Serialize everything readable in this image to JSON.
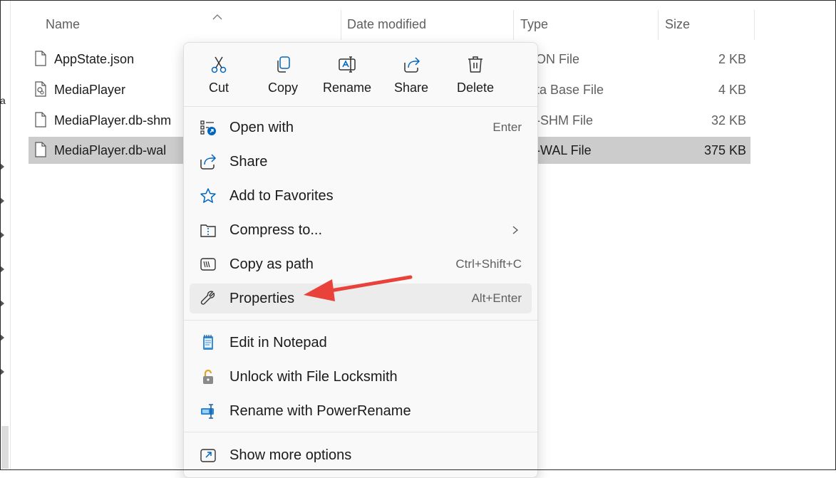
{
  "header": {
    "name": "Name",
    "date_modified": "Date modified",
    "type": "Type",
    "size": "Size"
  },
  "sidebar_stub": "a",
  "files": [
    {
      "name": "AppState.json",
      "type": "ON File",
      "size": "2 KB",
      "icon": "document-icon",
      "selected": false
    },
    {
      "name": "MediaPlayer",
      "type": "ta Base File",
      "size": "4 KB",
      "icon": "database-file-icon",
      "selected": false
    },
    {
      "name": "MediaPlayer.db-shm",
      "type": "-SHM File",
      "size": "32 KB",
      "icon": "document-icon",
      "selected": false
    },
    {
      "name": "MediaPlayer.db-wal",
      "type": "-WAL File",
      "size": "375 KB",
      "icon": "document-icon",
      "selected": true
    }
  ],
  "context_menu": {
    "quick_actions": [
      {
        "label": "Cut",
        "icon": "scissors-icon"
      },
      {
        "label": "Copy",
        "icon": "copy-icon"
      },
      {
        "label": "Rename",
        "icon": "rename-icon"
      },
      {
        "label": "Share",
        "icon": "share-icon"
      },
      {
        "label": "Delete",
        "icon": "trash-icon"
      }
    ],
    "items": [
      {
        "label": "Open with",
        "shortcut": "Enter",
        "icon": "open-with-icon"
      },
      {
        "label": "Share",
        "shortcut": "",
        "icon": "share-icon"
      },
      {
        "label": "Add to Favorites",
        "shortcut": "",
        "icon": "star-icon"
      },
      {
        "label": "Compress to...",
        "shortcut": "",
        "icon": "zip-folder-icon",
        "submenu": true
      },
      {
        "label": "Copy as path",
        "shortcut": "Ctrl+Shift+C",
        "icon": "copy-path-icon"
      },
      {
        "label": "Properties",
        "shortcut": "Alt+Enter",
        "icon": "wrench-icon",
        "highlighted": true
      }
    ],
    "extension_items": [
      {
        "label": "Edit in Notepad",
        "icon": "notepad-icon"
      },
      {
        "label": "Unlock with File Locksmith",
        "icon": "lock-icon"
      },
      {
        "label": "Rename with PowerRename",
        "icon": "power-rename-icon"
      }
    ],
    "footer_item": {
      "label": "Show more options",
      "icon": "show-more-icon"
    }
  },
  "colors": {
    "annotation_arrow": "#e8423b",
    "selection": "#cccccc",
    "menu_bg": "#f9f9f9",
    "accent": "#0067c0"
  }
}
